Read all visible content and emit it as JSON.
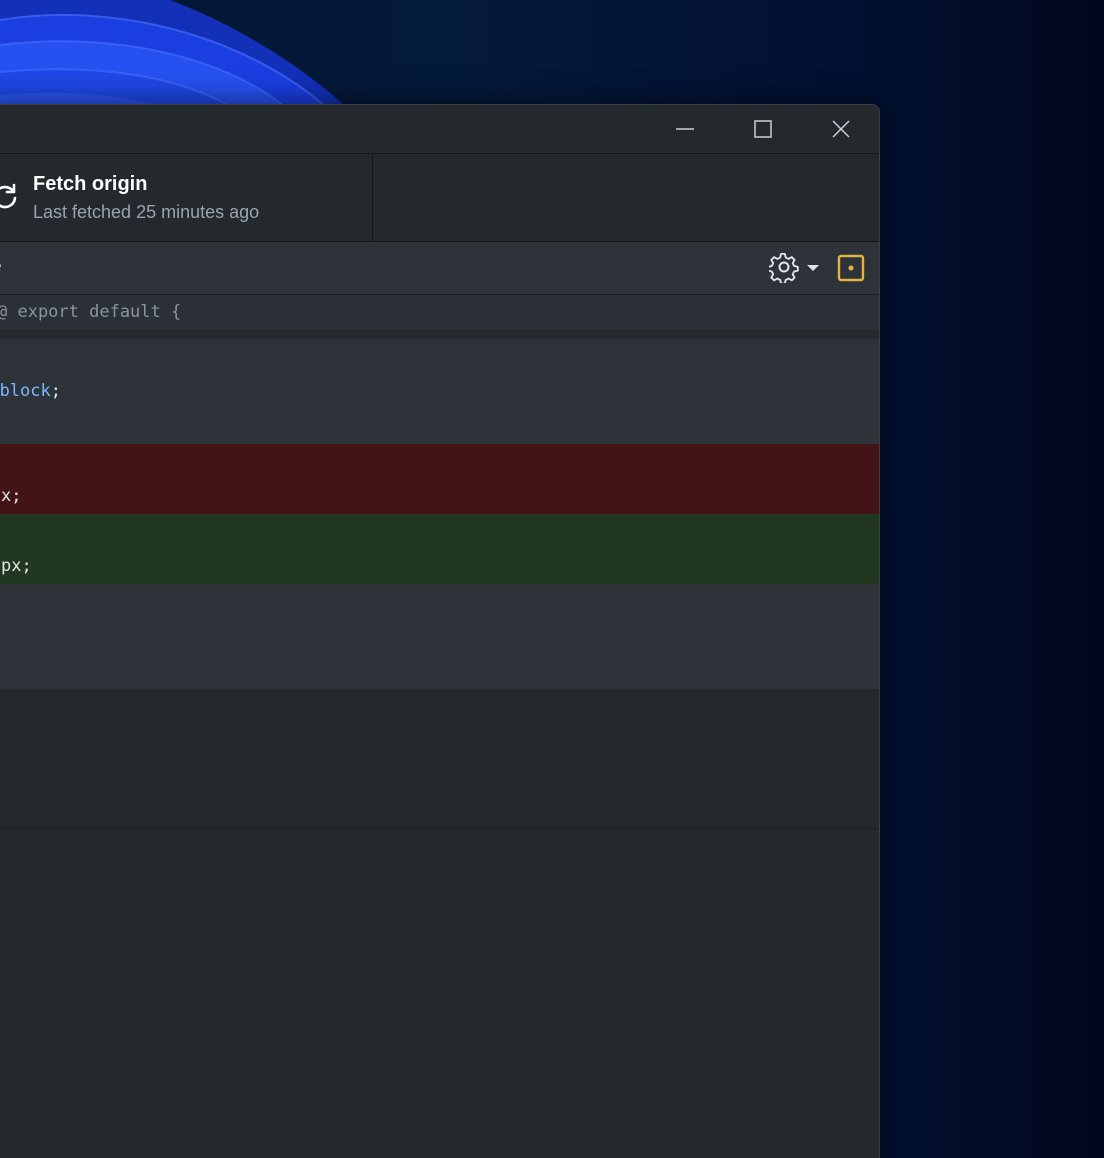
{
  "window": {
    "controls": {
      "minimize_icon": "minimize-icon",
      "maximize_icon": "maximize-icon",
      "close_icon": "close-icon"
    }
  },
  "toolbar": {
    "fetch": {
      "icon": "sync-icon",
      "title": "Fetch origin",
      "subtitle": "Last fetched 25 minutes ago"
    }
  },
  "diff": {
    "filename_fragment": "e",
    "settings_icon": "gear-icon",
    "dropdown_icon": "caret-down-icon",
    "expand_icon": "expand-icon",
    "hunk_header": "@ export default {",
    "lines": [
      {
        "type": "context",
        "prefix": "",
        "keyword": "",
        "suffix": ""
      },
      {
        "type": "context",
        "prefix": "",
        "keyword": "block",
        "suffix": ";"
      },
      {
        "type": "context",
        "prefix": "",
        "keyword": "",
        "suffix": ""
      },
      {
        "type": "deletion",
        "prefix": "",
        "keyword": "",
        "suffix": ""
      },
      {
        "type": "deletion",
        "prefix": "x;",
        "keyword": "",
        "suffix": ""
      },
      {
        "type": "addition",
        "prefix": "",
        "keyword": "",
        "suffix": ""
      },
      {
        "type": "addition",
        "prefix": "px;",
        "keyword": "",
        "suffix": ""
      },
      {
        "type": "context",
        "prefix": "",
        "keyword": "",
        "suffix": ""
      },
      {
        "type": "context",
        "prefix": "",
        "keyword": "",
        "suffix": ""
      },
      {
        "type": "context",
        "prefix": "",
        "keyword": "",
        "suffix": ""
      }
    ]
  },
  "colors": {
    "window_bg": "#24292e",
    "deletion_bg": "#431416",
    "addition_bg": "#22371f",
    "accent_yellow": "#e3b341",
    "keyword_blue": "#79b8ff"
  }
}
